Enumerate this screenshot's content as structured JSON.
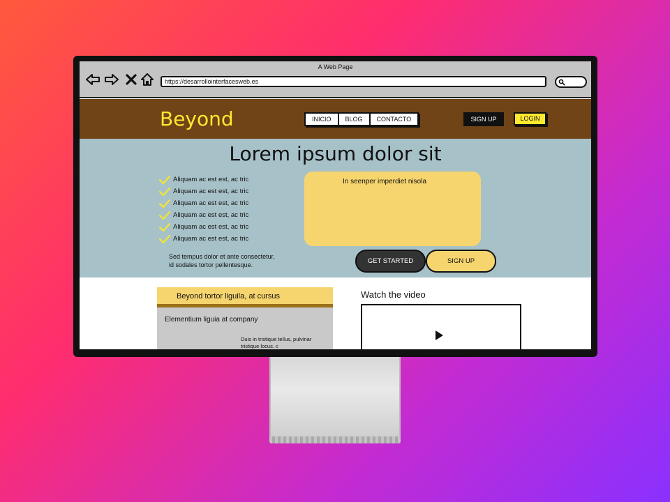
{
  "window": {
    "title": "A Web Page"
  },
  "browser": {
    "url": "https://desarrollointerfacesweb.es",
    "nav_icons": [
      "back-arrow-icon",
      "forward-arrow-icon",
      "close-icon",
      "home-icon",
      "search-icon"
    ]
  },
  "header": {
    "logo": "Beyond",
    "menu": [
      "INICIO",
      "BLOG",
      "CONTACTO"
    ],
    "signup": "SIGN UP",
    "login": "LOGIN"
  },
  "hero": {
    "title": "Lorem ipsum dolor sit",
    "checks": [
      "Aliquam ac est  est, ac tric",
      "Aliquam ac est  est, ac tric",
      "Aliquam ac est  est, ac tric",
      "Aliquam ac est  est, ac tric",
      "Aliquam ac est  est, ac tric",
      "Aliquam ac est  est, ac tric"
    ],
    "desc_line1": "Sed tempus dolor et ante consectetur,",
    "desc_line2": "id sodales tortor pellentesque.",
    "card_title": "In seenper imperdiet nisola",
    "get_started": "GET STARTED",
    "signup": "SIGN UP"
  },
  "feature": {
    "title": "Beyond tortor liguila, at cursus",
    "subtitle": "Elementium liguia at company",
    "small_text": "Duis in tristique tellus, pulvinar tristique locus. c"
  },
  "video": {
    "title": "Watch the video"
  },
  "colors": {
    "header_bg": "#714417",
    "logo": "#ffe930",
    "hero_bg": "#a6c1c8",
    "accent_yellow": "#f7d56e"
  }
}
